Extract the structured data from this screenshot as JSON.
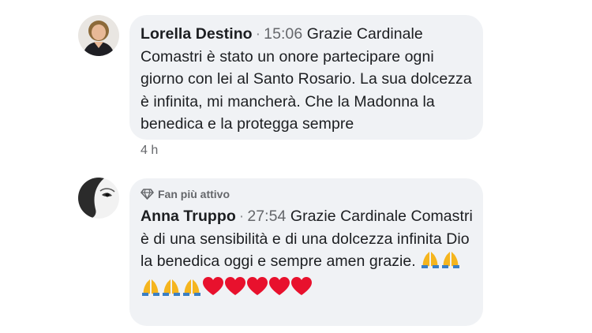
{
  "comments": [
    {
      "author": "Lorella Destino",
      "separator": "·",
      "timestamp": "15:06",
      "text_line1": "Grazie Cardinale",
      "text_rest": "Comastri è stato un onore partecipare ogni giorno con lei al Santo Rosario. La sua dolcezza è infinita, mi mancherà. Che la Madonna la benedica e la protegga sempre",
      "time_ago": "4 h",
      "avatar_icon": "person-photo-icon"
    },
    {
      "badge_label": "Fan più attivo",
      "badge_icon": "diamond-icon",
      "author": "Anna Truppo",
      "separator": "·",
      "timestamp": "27:54",
      "text_line1": "Grazie Cardinale",
      "text_rest": "Comastri è di una sensibilità e di una dolcezza infinita Dio la benedica oggi e sempre amen grazie.",
      "emoji_pray_count": 5,
      "emoji_heart_count": 5,
      "avatar_icon": "profile-photo-icon"
    }
  ],
  "colors": {
    "bubble_bg": "#f0f2f5",
    "text": "#1c1e21",
    "meta": "#65676b",
    "heart": "#e8112d",
    "pray": "#f5b51e"
  }
}
